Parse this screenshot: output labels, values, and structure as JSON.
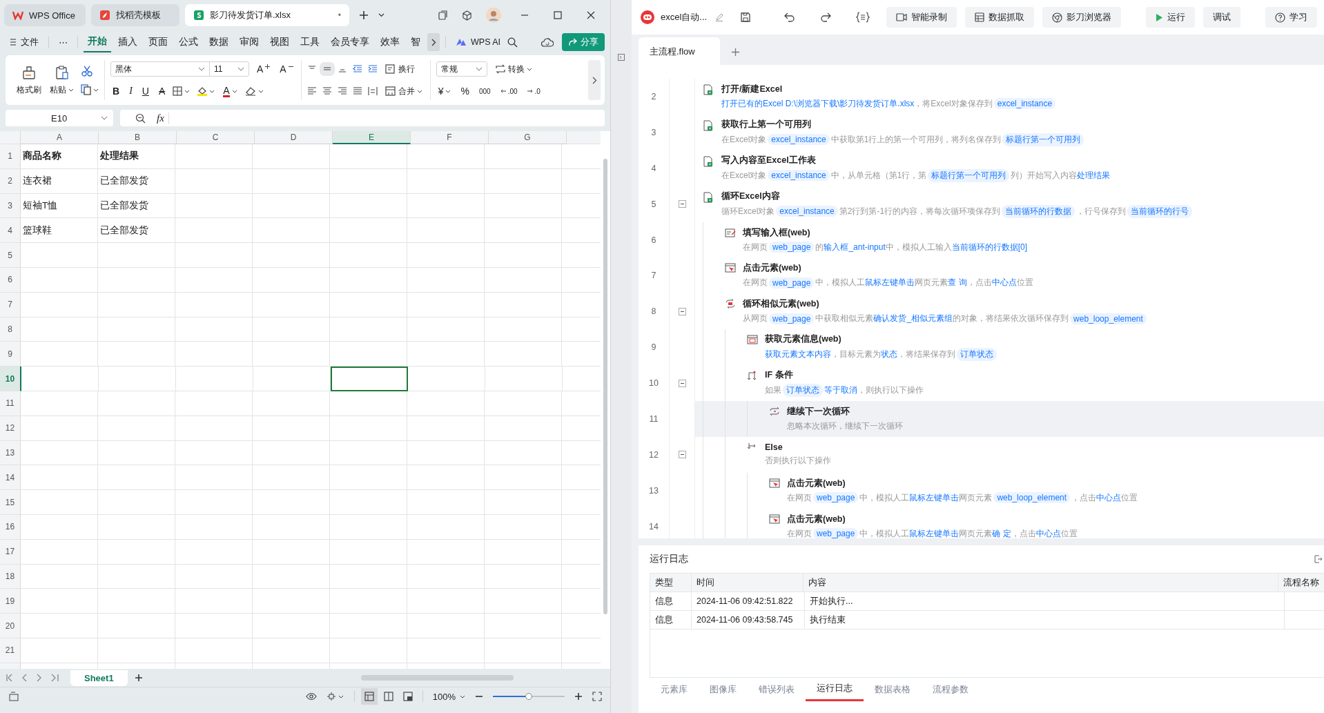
{
  "excel": {
    "tabs": [
      {
        "label": "WPS Office",
        "kind": "wps",
        "selected": false
      },
      {
        "label": "找稻壳模板",
        "kind": "docer",
        "selected": false
      },
      {
        "label": "影刀待发货订单.xlsx",
        "kind": "sheet",
        "selected": true,
        "mark": "•"
      }
    ],
    "menu": {
      "file": "文件",
      "more": "⋯",
      "tabs": [
        {
          "label": "开始",
          "selected": true
        },
        {
          "label": "插入",
          "selected": false
        },
        {
          "label": "页面",
          "selected": false
        },
        {
          "label": "公式",
          "selected": false
        },
        {
          "label": "数据",
          "selected": false
        },
        {
          "label": "审阅",
          "selected": false
        },
        {
          "label": "视图",
          "selected": false
        },
        {
          "label": "工具",
          "selected": false
        },
        {
          "label": "会员专享",
          "selected": false
        },
        {
          "label": "效率",
          "selected": false
        },
        {
          "label": "智",
          "selected": false
        }
      ],
      "ai": "WPS AI",
      "share": "分享"
    },
    "ribbon": {
      "format_painter": "格式刷",
      "paste": "粘贴",
      "font": "黑体",
      "size": "11",
      "size_buttons": [
        {
          "label": "A",
          "kind": "grow"
        },
        {
          "label": "A",
          "kind": "shrink"
        }
      ],
      "style_buttons": [
        {
          "label": "B",
          "kind": "bold"
        },
        {
          "label": "I",
          "kind": "italic"
        },
        {
          "label": "U",
          "kind": "underline"
        },
        {
          "label": "A",
          "kind": "strike"
        }
      ],
      "font_color": "A",
      "wrap": "换行",
      "merge": "合并",
      "number_format": "常规",
      "convert": "转换",
      "number_buttons": [
        {
          "label": "¥",
          "kind": "currency"
        },
        {
          "label": "%",
          "kind": "percent"
        },
        {
          "label": "000",
          "kind": "thousands"
        },
        {
          "label": ".00",
          "kind": "more_decimals"
        },
        {
          "label": ".0",
          "kind": "fewer_decimals"
        }
      ]
    },
    "formula_bar": {
      "cell": "E10",
      "fx": "fx"
    },
    "columns": [
      {
        "label": "A",
        "selected": false
      },
      {
        "label": "B",
        "selected": false
      },
      {
        "label": "C",
        "selected": false
      },
      {
        "label": "D",
        "selected": false
      },
      {
        "label": "E",
        "selected": true
      },
      {
        "label": "F",
        "selected": false
      },
      {
        "label": "G",
        "selected": false
      }
    ],
    "rows": [
      {
        "label": "1",
        "kind": "header",
        "selected": false,
        "cells": [
          "商品名称",
          "处理结果"
        ]
      },
      {
        "label": "2",
        "kind": "data",
        "selected": false,
        "cells": [
          "连衣裙",
          "已全部发货"
        ]
      },
      {
        "label": "3",
        "kind": "data",
        "selected": false,
        "cells": [
          "短袖T恤",
          "已全部发货"
        ]
      },
      {
        "label": "4",
        "kind": "data",
        "selected": false,
        "cells": [
          "篮球鞋",
          "已全部发货"
        ]
      },
      {
        "label": "5",
        "kind": "data",
        "selected": false
      },
      {
        "label": "6",
        "kind": "data",
        "selected": false
      },
      {
        "label": "7",
        "kind": "data",
        "selected": false
      },
      {
        "label": "8",
        "kind": "data",
        "selected": false
      },
      {
        "label": "9",
        "kind": "data",
        "selected": false
      },
      {
        "label": "10",
        "kind": "data",
        "selected": true
      },
      {
        "label": "11",
        "kind": "data",
        "selected": false
      },
      {
        "label": "12",
        "kind": "data",
        "selected": false
      },
      {
        "label": "13",
        "kind": "data",
        "selected": false
      },
      {
        "label": "14",
        "kind": "data",
        "selected": false
      },
      {
        "label": "15",
        "kind": "data",
        "selected": false
      },
      {
        "label": "16",
        "kind": "data",
        "selected": false
      },
      {
        "label": "17",
        "kind": "data",
        "selected": false
      },
      {
        "label": "18",
        "kind": "data",
        "selected": false
      },
      {
        "label": "19",
        "kind": "data",
        "selected": false
      },
      {
        "label": "20",
        "kind": "data",
        "selected": false
      },
      {
        "label": "21",
        "kind": "data",
        "selected": false
      }
    ],
    "sheet_tabs": [
      {
        "label": "Sheet1",
        "selected": true
      }
    ],
    "status": {
      "zoom": "100%",
      "zoom_slider": {
        "level": 0.5
      }
    }
  },
  "rpa": {
    "title": "excel自动...",
    "buttons": [
      {
        "label": "智能录制",
        "kind": "record"
      },
      {
        "label": "数据抓取",
        "kind": "grab"
      },
      {
        "label": "影刀浏览器",
        "kind": "browser"
      },
      {
        "label": "运行",
        "kind": "run"
      },
      {
        "label": "调试",
        "kind": "plain"
      },
      {
        "label": "学习",
        "kind": "help"
      }
    ],
    "tabs": [
      {
        "label": "主流程.flow",
        "selected": true
      }
    ],
    "steps": [
      {
        "line": "2",
        "kind": "excel",
        "title": "打开/新建Excel",
        "selected": false,
        "desc": [
          {
            "text": "打开已有的Excel D:\\浏览器下载\\影刀待发货订单.xlsx",
            "kind": "link"
          },
          {
            "text": "，将Excel对象保存到",
            "kind": "plain"
          },
          {
            "text": "excel_instance",
            "kind": "var"
          }
        ]
      },
      {
        "line": "3",
        "kind": "excel",
        "title": "获取行上第一个可用列",
        "selected": false,
        "desc": [
          {
            "text": "在Excel对象",
            "kind": "plain"
          },
          {
            "text": "excel_instance",
            "kind": "var"
          },
          {
            "text": "中获取第1行上的第一个可用列，将列名保存到",
            "kind": "plain"
          },
          {
            "text": "标题行第一个可用列",
            "kind": "var"
          }
        ]
      },
      {
        "line": "4",
        "kind": "excel",
        "title": "写入内容至Excel工作表",
        "selected": false,
        "desc": [
          {
            "text": "在Excel对象",
            "kind": "plain"
          },
          {
            "text": "excel_instance",
            "kind": "var"
          },
          {
            "text": "中，从单元格（第1行，第",
            "kind": "plain"
          },
          {
            "text": "标题行第一个可用列",
            "kind": "var"
          },
          {
            "text": "列）开始写入内容",
            "kind": "plain"
          },
          {
            "text": "处理结果",
            "kind": "link"
          }
        ]
      },
      {
        "line": "5",
        "kind": "excel",
        "title": "循环Excel内容",
        "selected": false,
        "expanded": true,
        "desc": [
          {
            "text": "循环Excel对象",
            "kind": "plain"
          },
          {
            "text": "excel_instance",
            "kind": "var"
          },
          {
            "text": "第2行到第-1行的内容，将每次循环项保存到",
            "kind": "plain"
          },
          {
            "text": "当前循环的行数据",
            "kind": "var"
          },
          {
            "text": "，行号保存到",
            "kind": "plain"
          },
          {
            "text": "当前循环的行号",
            "kind": "var"
          }
        ],
        "children": [
          {
            "line": "6",
            "kind": "input",
            "title": "填写输入框(web)",
            "selected": false,
            "desc": [
              {
                "text": "在网页",
                "kind": "plain"
              },
              {
                "text": "web_page",
                "kind": "var"
              },
              {
                "text": "的",
                "kind": "plain"
              },
              {
                "text": "输入框_ant-input",
                "kind": "link"
              },
              {
                "text": "中，模拟人工输入",
                "kind": "plain"
              },
              {
                "text": "当前循环的行数据[0]",
                "kind": "link"
              }
            ]
          },
          {
            "line": "7",
            "kind": "click",
            "title": "点击元素(web)",
            "selected": false,
            "desc": [
              {
                "text": "在网页",
                "kind": "plain"
              },
              {
                "text": "web_page",
                "kind": "var"
              },
              {
                "text": "中，模拟人工",
                "kind": "plain"
              },
              {
                "text": "鼠标左键单击",
                "kind": "link"
              },
              {
                "text": "网页元素",
                "kind": "plain"
              },
              {
                "text": "查 询",
                "kind": "link"
              },
              {
                "text": "，点击",
                "kind": "plain"
              },
              {
                "text": "中心点",
                "kind": "link"
              },
              {
                "text": "位置",
                "kind": "plain"
              }
            ]
          },
          {
            "line": "8",
            "kind": "loop",
            "title": "循环相似元素(web)",
            "selected": false,
            "expanded": true,
            "desc": [
              {
                "text": "从网页",
                "kind": "plain"
              },
              {
                "text": "web_page",
                "kind": "var"
              },
              {
                "text": "中获取相似元素",
                "kind": "plain"
              },
              {
                "text": "确认发货_相似元素组",
                "kind": "link"
              },
              {
                "text": "的对象，将结果依次循环保存到",
                "kind": "plain"
              },
              {
                "text": "web_loop_element",
                "kind": "var"
              }
            ],
            "children": [
              {
                "line": "9",
                "kind": "info",
                "title": "获取元素信息(web)",
                "selected": false,
                "desc": [
                  {
                    "text": "获取元素文本内容",
                    "kind": "link"
                  },
                  {
                    "text": "，目标元素为",
                    "kind": "plain"
                  },
                  {
                    "text": "状态",
                    "kind": "link"
                  },
                  {
                    "text": "，将结果保存到",
                    "kind": "plain"
                  },
                  {
                    "text": "订单状态",
                    "kind": "var"
                  }
                ]
              },
              {
                "line": "10",
                "kind": "if",
                "title": "IF 条件",
                "selected": false,
                "expanded": true,
                "desc": [
                  {
                    "text": "如果",
                    "kind": "plain"
                  },
                  {
                    "text": "订单状态",
                    "kind": "var"
                  },
                  {
                    "text": "等于取消",
                    "kind": "link"
                  },
                  {
                    "text": "，则执行以下操作",
                    "kind": "plain"
                  }
                ],
                "children": [
                  {
                    "line": "11",
                    "kind": "continue",
                    "title": "继续下一次循环",
                    "selected": true,
                    "desc": [
                      {
                        "text": "忽略本次循环，继续下一次循环",
                        "kind": "plain"
                      }
                    ]
                  }
                ]
              },
              {
                "line": "12",
                "kind": "else",
                "title": "Else",
                "selected": false,
                "expanded": true,
                "desc": [
                  {
                    "text": "否则执行以下操作",
                    "kind": "plain"
                  }
                ],
                "children": [
                  {
                    "line": "13",
                    "kind": "click",
                    "title": "点击元素(web)",
                    "selected": false,
                    "desc": [
                      {
                        "text": "在网页",
                        "kind": "plain"
                      },
                      {
                        "text": "web_page",
                        "kind": "var"
                      },
                      {
                        "text": "中，模拟人工",
                        "kind": "plain"
                      },
                      {
                        "text": "鼠标左键单击",
                        "kind": "link"
                      },
                      {
                        "text": "网页元素",
                        "kind": "plain"
                      },
                      {
                        "text": "web_loop_element",
                        "kind": "var"
                      },
                      {
                        "text": "，点击",
                        "kind": "plain"
                      },
                      {
                        "text": "中心点",
                        "kind": "link"
                      },
                      {
                        "text": "位置",
                        "kind": "plain"
                      }
                    ]
                  },
                  {
                    "line": "14",
                    "kind": "click",
                    "title": "点击元素(web)",
                    "selected": false,
                    "desc": [
                      {
                        "text": "在网页",
                        "kind": "plain"
                      },
                      {
                        "text": "web_page",
                        "kind": "var"
                      },
                      {
                        "text": "中，模拟人工",
                        "kind": "plain"
                      },
                      {
                        "text": "鼠标左键单击",
                        "kind": "link"
                      },
                      {
                        "text": "网页元素",
                        "kind": "plain"
                      },
                      {
                        "text": "确 定",
                        "kind": "link"
                      },
                      {
                        "text": "，点击",
                        "kind": "plain"
                      },
                      {
                        "text": "中心点",
                        "kind": "link"
                      },
                      {
                        "text": "位置",
                        "kind": "plain"
                      }
                    ]
                  }
                ]
              }
            ]
          }
        ]
      }
    ],
    "log": {
      "title": "运行日志",
      "columns": [
        "类型",
        "时间",
        "内容",
        "流程名称"
      ],
      "rows": [
        [
          "信息",
          "2024-11-06 09:42:51.822",
          "开始执行..."
        ],
        [
          "信息",
          "2024-11-06 09:43:58.745",
          "执行结束"
        ]
      ]
    },
    "bottom_tabs": [
      {
        "label": "元素库",
        "selected": false
      },
      {
        "label": "图像库",
        "selected": false
      },
      {
        "label": "错误列表",
        "selected": false
      },
      {
        "label": "运行日志",
        "selected": true
      },
      {
        "label": "数据表格",
        "selected": false
      },
      {
        "label": "流程参数",
        "selected": false
      }
    ]
  }
}
